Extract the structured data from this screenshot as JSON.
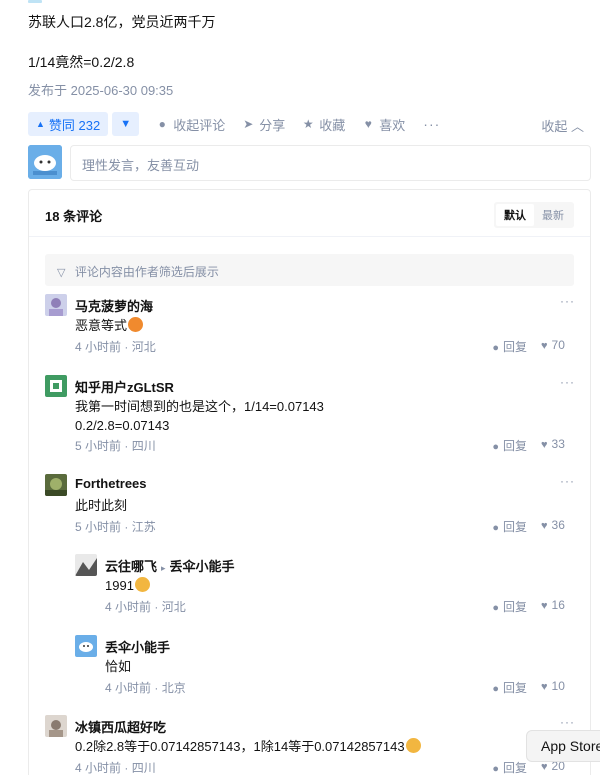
{
  "answer": {
    "paragraphs": [
      "苏联人口2.8亿，党员近两千万",
      "1/14竟然=0.2/2.8"
    ],
    "published": "发布于 2025-06-30 09:35"
  },
  "actions": {
    "vote_up": "赞同 232",
    "collapse_comments": "收起评论",
    "share": "分享",
    "favorite": "收藏",
    "like": "喜欢",
    "more": "···",
    "fold": "收起"
  },
  "composer": {
    "placeholder": "理性发言，友善互动"
  },
  "comments": {
    "count_label": "18 条评论",
    "sort_default": "默认",
    "sort_latest": "最新",
    "filter_notice": "评论内容由作者筛选后展示",
    "items": [
      {
        "user": "马克菠萝的海",
        "text": "恶意等式",
        "time": "4 小时前",
        "loc": "河北",
        "reply": "回复",
        "likes": "70"
      },
      {
        "user": "知乎用户zGLtSR",
        "text": "我第一时间想到的也是这个，1/14=0.07143",
        "text2": "0.2/2.8=0.07143",
        "time": "5 小时前",
        "loc": "四川",
        "reply": "回复",
        "likes": "33"
      },
      {
        "user": "Forthetrees",
        "text": "此时此刻",
        "time": "5 小时前",
        "loc": "江苏",
        "reply": "回复",
        "likes": "36"
      },
      {
        "user": "云往哪飞",
        "to": "丢伞小能手",
        "text": "1991",
        "time": "4 小时前",
        "loc": "河北",
        "reply": "回复",
        "likes": "16"
      },
      {
        "user": "丢伞小能手",
        "text": "恰如",
        "time": "4 小时前",
        "loc": "北京",
        "reply": "回复",
        "likes": "10"
      },
      {
        "user": "冰镇西瓜超好吃",
        "text": "0.2除2.8等于0.07142857143，1除14等于0.07142857143",
        "time": "4 小时前",
        "loc": "四川",
        "reply": "回复",
        "likes": "20"
      }
    ]
  },
  "overlay": {
    "app_store": "App Store"
  },
  "colors": {
    "accent": "#1772f6",
    "accent_bg": "#e6effe",
    "muted": "#8590a6"
  }
}
